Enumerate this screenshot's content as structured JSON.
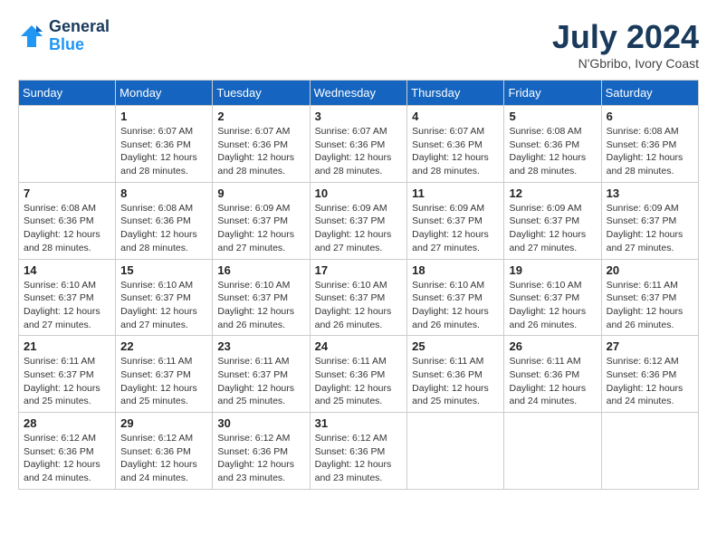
{
  "header": {
    "logo_general": "General",
    "logo_blue": "Blue",
    "month_year": "July 2024",
    "location": "N'Gbribo, Ivory Coast"
  },
  "days_of_week": [
    "Sunday",
    "Monday",
    "Tuesday",
    "Wednesday",
    "Thursday",
    "Friday",
    "Saturday"
  ],
  "weeks": [
    [
      {
        "day": "",
        "info": ""
      },
      {
        "day": "1",
        "info": "Sunrise: 6:07 AM\nSunset: 6:36 PM\nDaylight: 12 hours\nand 28 minutes."
      },
      {
        "day": "2",
        "info": "Sunrise: 6:07 AM\nSunset: 6:36 PM\nDaylight: 12 hours\nand 28 minutes."
      },
      {
        "day": "3",
        "info": "Sunrise: 6:07 AM\nSunset: 6:36 PM\nDaylight: 12 hours\nand 28 minutes."
      },
      {
        "day": "4",
        "info": "Sunrise: 6:07 AM\nSunset: 6:36 PM\nDaylight: 12 hours\nand 28 minutes."
      },
      {
        "day": "5",
        "info": "Sunrise: 6:08 AM\nSunset: 6:36 PM\nDaylight: 12 hours\nand 28 minutes."
      },
      {
        "day": "6",
        "info": "Sunrise: 6:08 AM\nSunset: 6:36 PM\nDaylight: 12 hours\nand 28 minutes."
      }
    ],
    [
      {
        "day": "7",
        "info": "Sunrise: 6:08 AM\nSunset: 6:36 PM\nDaylight: 12 hours\nand 28 minutes."
      },
      {
        "day": "8",
        "info": "Sunrise: 6:08 AM\nSunset: 6:36 PM\nDaylight: 12 hours\nand 28 minutes."
      },
      {
        "day": "9",
        "info": "Sunrise: 6:09 AM\nSunset: 6:37 PM\nDaylight: 12 hours\nand 27 minutes."
      },
      {
        "day": "10",
        "info": "Sunrise: 6:09 AM\nSunset: 6:37 PM\nDaylight: 12 hours\nand 27 minutes."
      },
      {
        "day": "11",
        "info": "Sunrise: 6:09 AM\nSunset: 6:37 PM\nDaylight: 12 hours\nand 27 minutes."
      },
      {
        "day": "12",
        "info": "Sunrise: 6:09 AM\nSunset: 6:37 PM\nDaylight: 12 hours\nand 27 minutes."
      },
      {
        "day": "13",
        "info": "Sunrise: 6:09 AM\nSunset: 6:37 PM\nDaylight: 12 hours\nand 27 minutes."
      }
    ],
    [
      {
        "day": "14",
        "info": "Sunrise: 6:10 AM\nSunset: 6:37 PM\nDaylight: 12 hours\nand 27 minutes."
      },
      {
        "day": "15",
        "info": "Sunrise: 6:10 AM\nSunset: 6:37 PM\nDaylight: 12 hours\nand 27 minutes."
      },
      {
        "day": "16",
        "info": "Sunrise: 6:10 AM\nSunset: 6:37 PM\nDaylight: 12 hours\nand 26 minutes."
      },
      {
        "day": "17",
        "info": "Sunrise: 6:10 AM\nSunset: 6:37 PM\nDaylight: 12 hours\nand 26 minutes."
      },
      {
        "day": "18",
        "info": "Sunrise: 6:10 AM\nSunset: 6:37 PM\nDaylight: 12 hours\nand 26 minutes."
      },
      {
        "day": "19",
        "info": "Sunrise: 6:10 AM\nSunset: 6:37 PM\nDaylight: 12 hours\nand 26 minutes."
      },
      {
        "day": "20",
        "info": "Sunrise: 6:11 AM\nSunset: 6:37 PM\nDaylight: 12 hours\nand 26 minutes."
      }
    ],
    [
      {
        "day": "21",
        "info": "Sunrise: 6:11 AM\nSunset: 6:37 PM\nDaylight: 12 hours\nand 25 minutes."
      },
      {
        "day": "22",
        "info": "Sunrise: 6:11 AM\nSunset: 6:37 PM\nDaylight: 12 hours\nand 25 minutes."
      },
      {
        "day": "23",
        "info": "Sunrise: 6:11 AM\nSunset: 6:37 PM\nDaylight: 12 hours\nand 25 minutes."
      },
      {
        "day": "24",
        "info": "Sunrise: 6:11 AM\nSunset: 6:36 PM\nDaylight: 12 hours\nand 25 minutes."
      },
      {
        "day": "25",
        "info": "Sunrise: 6:11 AM\nSunset: 6:36 PM\nDaylight: 12 hours\nand 25 minutes."
      },
      {
        "day": "26",
        "info": "Sunrise: 6:11 AM\nSunset: 6:36 PM\nDaylight: 12 hours\nand 24 minutes."
      },
      {
        "day": "27",
        "info": "Sunrise: 6:12 AM\nSunset: 6:36 PM\nDaylight: 12 hours\nand 24 minutes."
      }
    ],
    [
      {
        "day": "28",
        "info": "Sunrise: 6:12 AM\nSunset: 6:36 PM\nDaylight: 12 hours\nand 24 minutes."
      },
      {
        "day": "29",
        "info": "Sunrise: 6:12 AM\nSunset: 6:36 PM\nDaylight: 12 hours\nand 24 minutes."
      },
      {
        "day": "30",
        "info": "Sunrise: 6:12 AM\nSunset: 6:36 PM\nDaylight: 12 hours\nand 23 minutes."
      },
      {
        "day": "31",
        "info": "Sunrise: 6:12 AM\nSunset: 6:36 PM\nDaylight: 12 hours\nand 23 minutes."
      },
      {
        "day": "",
        "info": ""
      },
      {
        "day": "",
        "info": ""
      },
      {
        "day": "",
        "info": ""
      }
    ]
  ]
}
